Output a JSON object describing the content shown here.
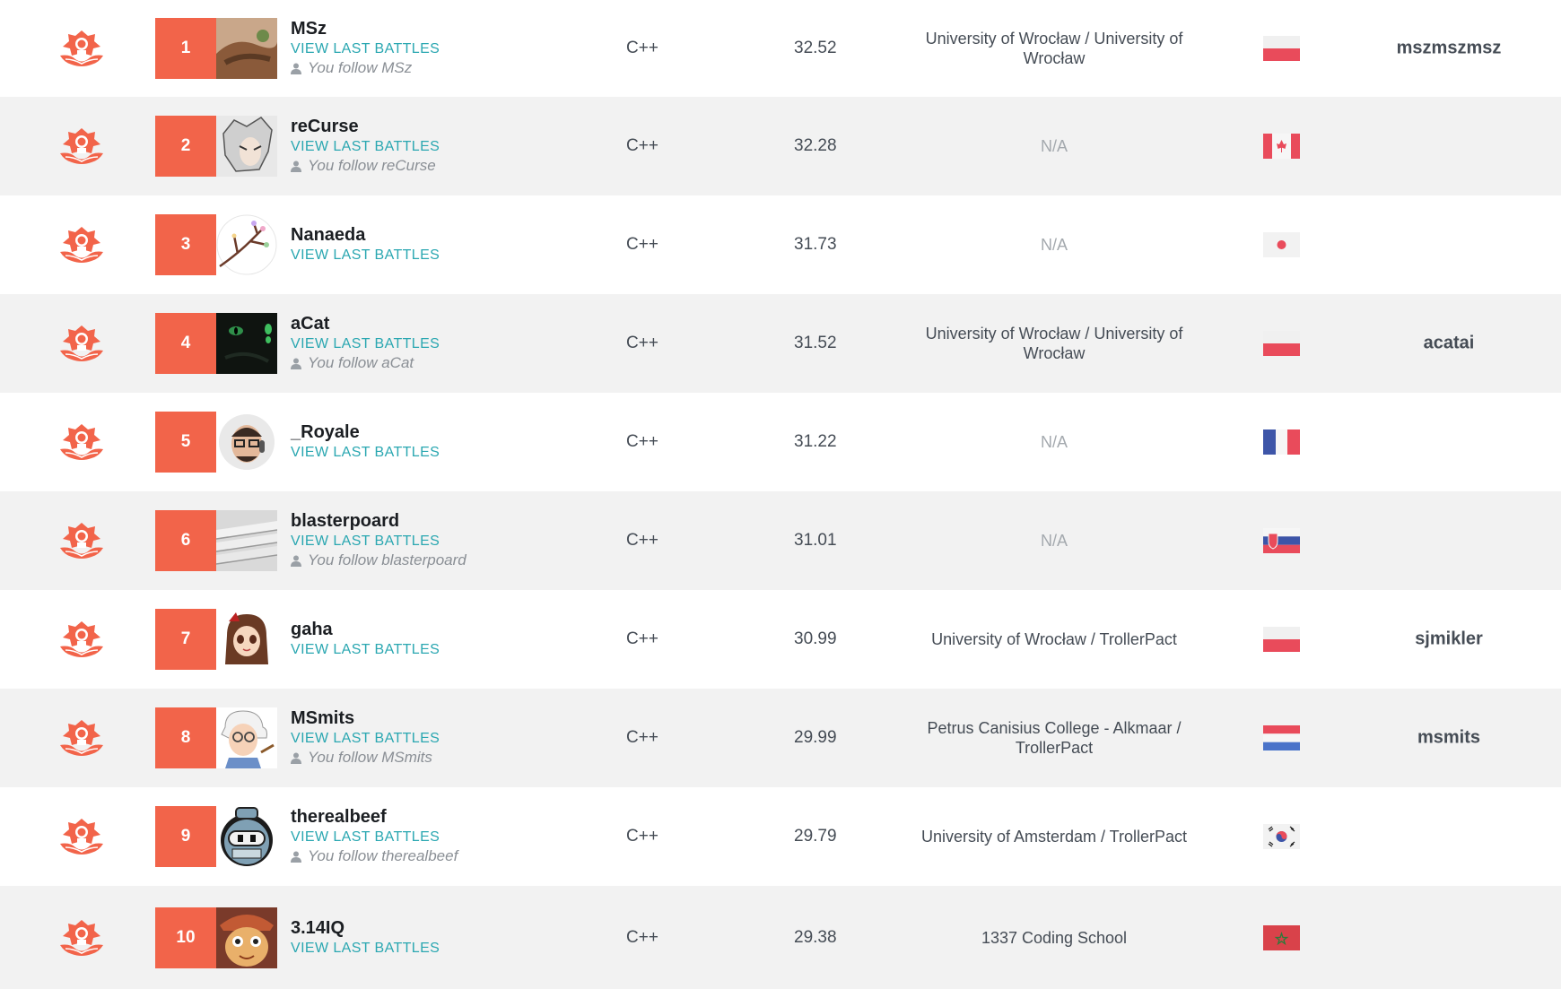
{
  "colors": {
    "accent": "#f2644a",
    "link": "#2aa7b1",
    "muted": "#a4a9ae",
    "alt_row": "#f2f2f2"
  },
  "league_icon": "legend-league-icon",
  "rows": [
    {
      "rank": "1",
      "name": "MSz",
      "battles": "VIEW LAST BATTLES",
      "follow": "You follow MSz",
      "language": "C++",
      "score": "32.52",
      "school": "University of Wrocław / University of Wrocław",
      "flag": "poland",
      "company": "mszmszmsz"
    },
    {
      "rank": "2",
      "name": "reCurse",
      "battles": "VIEW LAST BATTLES",
      "follow": "You follow reCurse",
      "language": "C++",
      "score": "32.28",
      "school": "N/A",
      "flag": "canada",
      "company": ""
    },
    {
      "rank": "3",
      "name": "Nanaeda",
      "battles": "VIEW LAST BATTLES",
      "follow": "",
      "language": "C++",
      "score": "31.73",
      "school": "N/A",
      "flag": "japan",
      "company": ""
    },
    {
      "rank": "4",
      "name": "aCat",
      "battles": "VIEW LAST BATTLES",
      "follow": "You follow aCat",
      "language": "C++",
      "score": "31.52",
      "school": "University of Wrocław / University of Wrocław",
      "flag": "poland",
      "company": "acatai"
    },
    {
      "rank": "5",
      "name": "_Royale",
      "battles": "VIEW LAST BATTLES",
      "follow": "",
      "language": "C++",
      "score": "31.22",
      "school": "N/A",
      "flag": "france",
      "company": ""
    },
    {
      "rank": "6",
      "name": "blasterpoard",
      "battles": "VIEW LAST BATTLES",
      "follow": "You follow blasterpoard",
      "language": "C++",
      "score": "31.01",
      "school": "N/A",
      "flag": "slovakia",
      "company": ""
    },
    {
      "rank": "7",
      "name": "gaha",
      "battles": "VIEW LAST BATTLES",
      "follow": "",
      "language": "C++",
      "score": "30.99",
      "school": "University of Wrocław / TrollerPact",
      "flag": "poland",
      "company": "sjmikler"
    },
    {
      "rank": "8",
      "name": "MSmits",
      "battles": "VIEW LAST BATTLES",
      "follow": "You follow MSmits",
      "language": "C++",
      "score": "29.99",
      "school": "Petrus Canisius College - Alkmaar / TrollerPact",
      "flag": "netherlands",
      "company": "msmits"
    },
    {
      "rank": "9",
      "name": "therealbeef",
      "battles": "VIEW LAST BATTLES",
      "follow": "You follow therealbeef",
      "language": "C++",
      "score": "29.79",
      "school": "University of Amsterdam / TrollerPact",
      "flag": "south-korea",
      "company": ""
    },
    {
      "rank": "10",
      "name": "3.14IQ",
      "battles": "VIEW LAST BATTLES",
      "follow": "",
      "language": "C++",
      "score": "29.38",
      "school": "1337 Coding School",
      "flag": "morocco",
      "company": ""
    }
  ]
}
